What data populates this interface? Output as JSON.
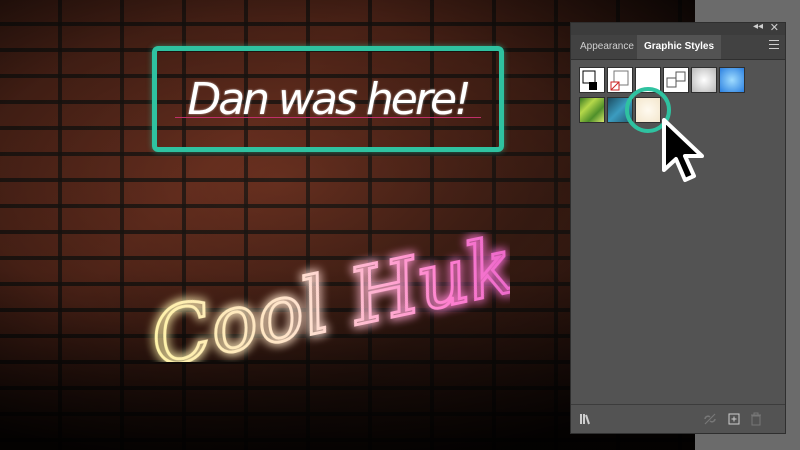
{
  "artwork": {
    "headline": "Dan was here!",
    "neon_script": "Cool Huk!",
    "frame_color": "#2fc2a0"
  },
  "panel": {
    "tabs": [
      {
        "label": "Appearance",
        "active": false
      },
      {
        "label": "Graphic Styles",
        "active": true
      }
    ],
    "collapse_glyph": "◂◂",
    "close_glyph": "✕",
    "menu_icon": "hamburger-menu-icon",
    "swatches": [
      {
        "name": "default-black-stroke-style",
        "bg": "#ffffff"
      },
      {
        "name": "no-stroke-style",
        "bg": "#ffffff"
      },
      {
        "name": "white-fill-style",
        "bg": "#ffffff"
      },
      {
        "name": "double-square-style",
        "bg": "#ffffff"
      },
      {
        "name": "gray-gradient-style",
        "bg": "#d0d0d0"
      },
      {
        "name": "blue-glow-style",
        "bg": "#3a8ee0"
      },
      {
        "name": "green-texture-style",
        "bg": "#7fb33a"
      },
      {
        "name": "blue-texture-style",
        "bg": "#2e6f8a"
      },
      {
        "name": "neon-cream-style",
        "bg": "#f7eedc"
      }
    ],
    "bottom_icons": [
      "graphic-styles-libraries-icon",
      "break-link-icon",
      "new-style-icon",
      "delete-style-icon"
    ]
  },
  "colors": {
    "panel_bg": "#535353",
    "accent": "#2fc2a0"
  }
}
